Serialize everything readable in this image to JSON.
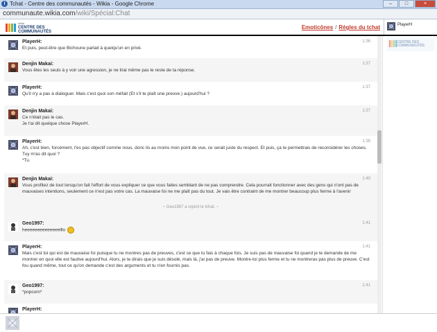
{
  "window": {
    "title": "Tchat - Centre des communautés - Wikia - Google Chrome",
    "buttons": [
      "–",
      "□",
      "×"
    ]
  },
  "address": {
    "domain": "communaute.wikia.com",
    "path": "/wiki/Spécial:Chat"
  },
  "header": {
    "logo_small": "wikia",
    "logo_line1": "CENTRE DES",
    "logo_line2": "COMMUNAUTÉS",
    "emoticons": "Emoticônes",
    "separator": "/",
    "rules": "Règles du tchat",
    "current_user": "PlayerH"
  },
  "userlist_logo": {
    "line1": "CENTRE DES",
    "line2": "COMMUNAUTÉS"
  },
  "messages": [
    {
      "user": "PlayerH:",
      "time": "1:36",
      "avatar": "playerh",
      "text": "Et puis, peut-être que Bichoune parlait à quelqu'un en privé."
    },
    {
      "user": "Denjin Makai:",
      "time": "1:37",
      "avatar": "denjin",
      "text": "Vous êtes les seuls à y voir une agression, je ne lirai même pas le reste de ta réponse."
    },
    {
      "user": "PlayerH:",
      "time": "1:37",
      "avatar": "playerh",
      "text": "Qu'il n'y a pas à dialoguer. Mais c'est quoi son méfait (Et s'il te plaît une preuve.) aujourd'hui ?"
    },
    {
      "user": "Denjin Makai:",
      "time": "1:37",
      "avatar": "denjin",
      "text": "Ce n'était pas le cas.\nJe t'ai dit quelque chose PlayerH."
    },
    {
      "user": "PlayerH:",
      "time": "1:38",
      "avatar": "playerh",
      "text": "Ah, c'est bien, forcément, t'es pas objectif comme nous, donc lis au moins mon point de vue, ce serait juste du respect. Et puis, ça te permettrais de reconsidérer les choses.\nTuy m'as dit quoi ?\n*Tu."
    },
    {
      "user": "Denjin Makai:",
      "time": "1:40",
      "avatar": "denjin",
      "text": "Vous profitez de tout lorsqu'on fait l'effort de vous expliquer ce que vous faites semblant de ne pas comprendre. Cela pourrait fonctionner avec des gens qui n'ont pas de mauvaises intentions, seulement ce n'est pas votre cas. La mauvaise foi ne me plaît pas du tout. Je vais être contraint de me montrer beaucoup plus ferme à l'avenir"
    },
    {
      "user": "Geo1997:",
      "time": "1:41",
      "avatar": "geo",
      "text": "heeeeeeeeeeeeeelllo"
    },
    {
      "user": "PlayerH:",
      "time": "1:41",
      "avatar": "playerh",
      "text": "Mais c'est toi qui est de mauvaise foi puisque tu ne montres pas de preuves, c'est ce que tu fais à chaque fois. Je suis pas de mauvaise foi quand je te demande de me montrer en quoi elle est fautive aujourd'hui. Alors, je te dirais que je suis désolé, mais là, j'ai pas de preuve. Montre-toi plus ferme et tu ne montreras pas plus de preuve. C'est fou quand même, tout ce qu'on demande c'est des arguments et tu n'en fournis pas."
    },
    {
      "user": "Geo1997:",
      "time": "1:41",
      "avatar": "geo",
      "text": "*popcorn*"
    },
    {
      "user": "PlayerH:",
      "time": "",
      "avatar": "playerh",
      "text": ""
    }
  ],
  "join_notice": "~ Geo1997 a rejoint le tchat. ~",
  "input": {
    "placeholder": ""
  },
  "colors": {
    "accent_link": "#c0392b",
    "header_border": "#000000",
    "alt_row": "#f5f5f5"
  }
}
